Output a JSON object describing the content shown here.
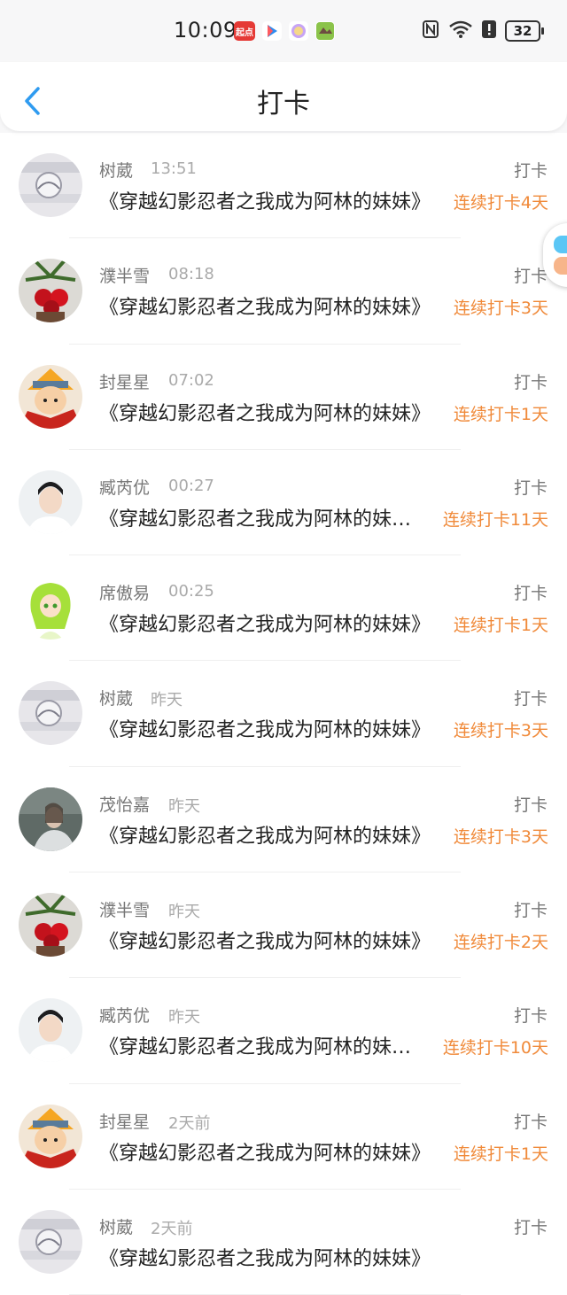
{
  "status_bar": {
    "time": "10:09",
    "apps": [
      "起点"
    ],
    "battery": "32"
  },
  "header": {
    "title": "打卡"
  },
  "rows": [
    {
      "name": "树葳",
      "time": "13:51",
      "action": "打卡",
      "content": "《穿越幻影忍者之我成为阿林的妹妹》",
      "streak": "连续打卡4天",
      "avatar": "marble-drawing"
    },
    {
      "name": "濮半雪",
      "time": "08:18",
      "action": "打卡",
      "content": "《穿越幻影忍者之我成为阿林的妹妹》",
      "streak": "连续打卡3天",
      "avatar": "red-flowers"
    },
    {
      "name": "封星星",
      "time": "07:02",
      "action": "打卡",
      "content": "《穿越幻影忍者之我成为阿林的妹妹》",
      "streak": "连续打卡1天",
      "avatar": "anime-ninja"
    },
    {
      "name": "臧芮优",
      "time": "00:27",
      "action": "打卡",
      "content": "《穿越幻影忍者之我成为阿林的妹妹》",
      "streak": "连续打卡11天",
      "avatar": "young-man-white"
    },
    {
      "name": "席傲易",
      "time": "00:25",
      "action": "打卡",
      "content": "《穿越幻影忍者之我成为阿林的妹妹》",
      "streak": "连续打卡1天",
      "avatar": "green-anime-girl"
    },
    {
      "name": "树葳",
      "time": "昨天",
      "action": "打卡",
      "content": "《穿越幻影忍者之我成为阿林的妹妹》",
      "streak": "连续打卡3天",
      "avatar": "marble-drawing"
    },
    {
      "name": "茂怡嘉",
      "time": "昨天",
      "action": "打卡",
      "content": "《穿越幻影忍者之我成为阿林的妹妹》",
      "streak": "连续打卡3天",
      "avatar": "dark-portrait"
    },
    {
      "name": "濮半雪",
      "time": "昨天",
      "action": "打卡",
      "content": "《穿越幻影忍者之我成为阿林的妹妹》",
      "streak": "连续打卡2天",
      "avatar": "red-flowers"
    },
    {
      "name": "臧芮优",
      "time": "昨天",
      "action": "打卡",
      "content": "《穿越幻影忍者之我成为阿林的妹妹》",
      "streak": "连续打卡10天",
      "avatar": "young-man-white"
    },
    {
      "name": "封星星",
      "time": "2天前",
      "action": "打卡",
      "content": "《穿越幻影忍者之我成为阿林的妹妹》",
      "streak": "连续打卡1天",
      "avatar": "anime-ninja"
    },
    {
      "name": "树葳",
      "time": "2天前",
      "action": "打卡",
      "content": "《穿越幻影忍者之我成为阿林的妹妹》",
      "streak": "",
      "avatar": "marble-drawing"
    }
  ],
  "colors": {
    "accent_orange": "#f08a3a",
    "back_blue": "#2f9bf0",
    "text_primary": "#222222",
    "text_secondary": "#777777"
  }
}
